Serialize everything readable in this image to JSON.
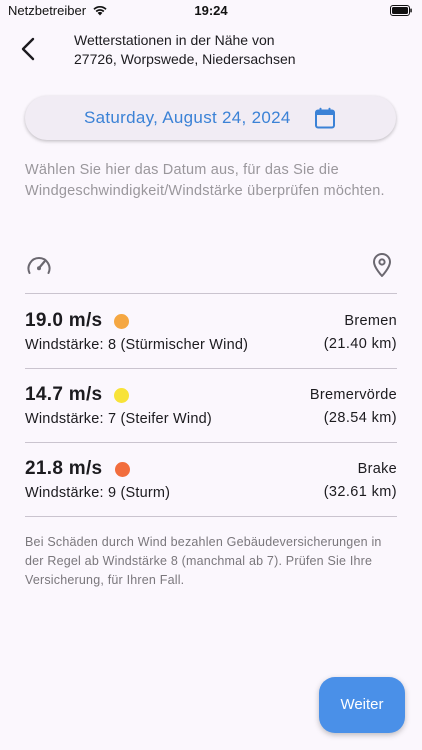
{
  "status_bar": {
    "carrier": "Netzbetreiber",
    "time": "19:24"
  },
  "header": {
    "title_line1": "Wetterstationen in der Nähe von",
    "title_line2": "27726, Worpswede, Niedersachsen"
  },
  "date_picker": {
    "label": "Saturday, August 24, 2024",
    "icon": "calendar-icon",
    "color": "#3b82d6"
  },
  "hint": "Wählen Sie hier das Datum aus, für das Sie die Windgeschwindigkeit/Windstärke überprüfen möchten.",
  "columns": {
    "left_icon": "gauge-icon",
    "right_icon": "location-icon"
  },
  "stations": [
    {
      "speed": "19.0 m/s",
      "dot_color": "#f5a742",
      "beaufort": "Windstärke: 8 (Stürmischer Wind)",
      "name": "Bremen",
      "distance": "(21.40 km)"
    },
    {
      "speed": "14.7 m/s",
      "dot_color": "#f8e339",
      "beaufort": "Windstärke: 7 (Steifer Wind)",
      "name": "Bremervörde",
      "distance": "(28.54 km)"
    },
    {
      "speed": "21.8 m/s",
      "dot_color": "#f26d3d",
      "beaufort": "Windstärke: 9 (Sturm)",
      "name": "Brake",
      "distance": "(32.61 km)"
    }
  ],
  "note": "Bei Schäden durch Wind bezahlen Gebäudeversicherungen in der Regel ab Windstärke 8 (manchmal ab 7). Prüfen Sie Ihre Versicherung, für Ihren Fall.",
  "next_button": {
    "label": "Weiter",
    "color": "#4a90e8"
  }
}
